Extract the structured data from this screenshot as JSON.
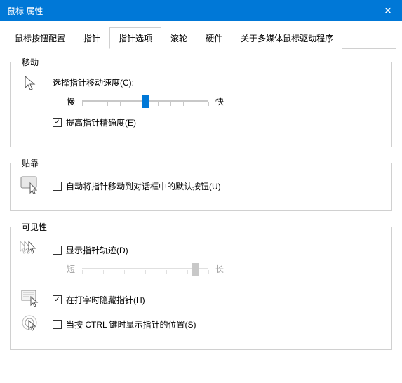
{
  "window": {
    "title": "鼠标 属性"
  },
  "tabs": {
    "items": [
      {
        "label": "鼠标按钮配置"
      },
      {
        "label": "指针"
      },
      {
        "label": "指针选项"
      },
      {
        "label": "滚轮"
      },
      {
        "label": "硬件"
      },
      {
        "label": "关于多媒体鼠标驱动程序"
      }
    ],
    "active_index": 2
  },
  "groups": {
    "motion": {
      "legend": "移动",
      "speed_label": "选择指针移动速度(C):",
      "slow": "慢",
      "fast": "快",
      "enhance_precision": "提高指针精确度(E)",
      "speed_value": 0.5
    },
    "snap": {
      "legend": "贴靠",
      "auto_snap": "自动将指针移动到对话框中的默认按钮(U)"
    },
    "visibility": {
      "legend": "可见性",
      "show_trails": "显示指针轨迹(D)",
      "trail_short": "短",
      "trail_long": "长",
      "hide_while_typing": "在打字时隐藏指针(H)",
      "show_location_ctrl": "当按 CTRL 键时显示指针的位置(S)",
      "trail_value": 0.9
    }
  },
  "state": {
    "enhance_precision_checked": true,
    "auto_snap_checked": false,
    "show_trails_checked": false,
    "hide_while_typing_checked": true,
    "show_location_ctrl_checked": false
  }
}
